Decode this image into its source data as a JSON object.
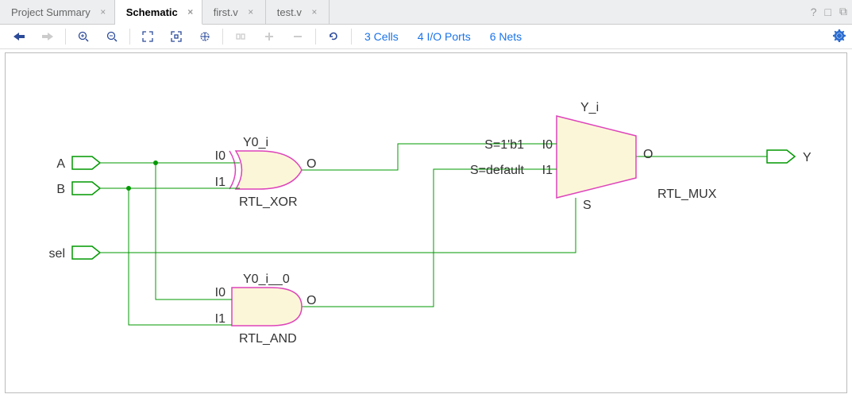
{
  "tabs": {
    "0": {
      "label": "Project Summary"
    },
    "1": {
      "label": "Schematic"
    },
    "2": {
      "label": "first.v"
    },
    "3": {
      "label": "test.v"
    }
  },
  "toolbar_info": {
    "cells": "3 Cells",
    "ports": "4 I/O Ports",
    "nets": "6 Nets"
  },
  "ports": {
    "A": "A",
    "B": "B",
    "sel": "sel",
    "Y": "Y"
  },
  "gates": {
    "xor": {
      "inst": "Y0_i",
      "type": "RTL_XOR",
      "i0": "I0",
      "i1": "I1",
      "o": "O"
    },
    "and": {
      "inst": "Y0_i__0",
      "type": "RTL_AND",
      "i0": "I0",
      "i1": "I1",
      "o": "O"
    },
    "mux": {
      "inst": "Y_i",
      "type": "RTL_MUX",
      "i0": "I0",
      "i1": "I1",
      "o": "O",
      "s": "S",
      "s0v": "S=1'b1",
      "s1v": "S=default"
    }
  }
}
